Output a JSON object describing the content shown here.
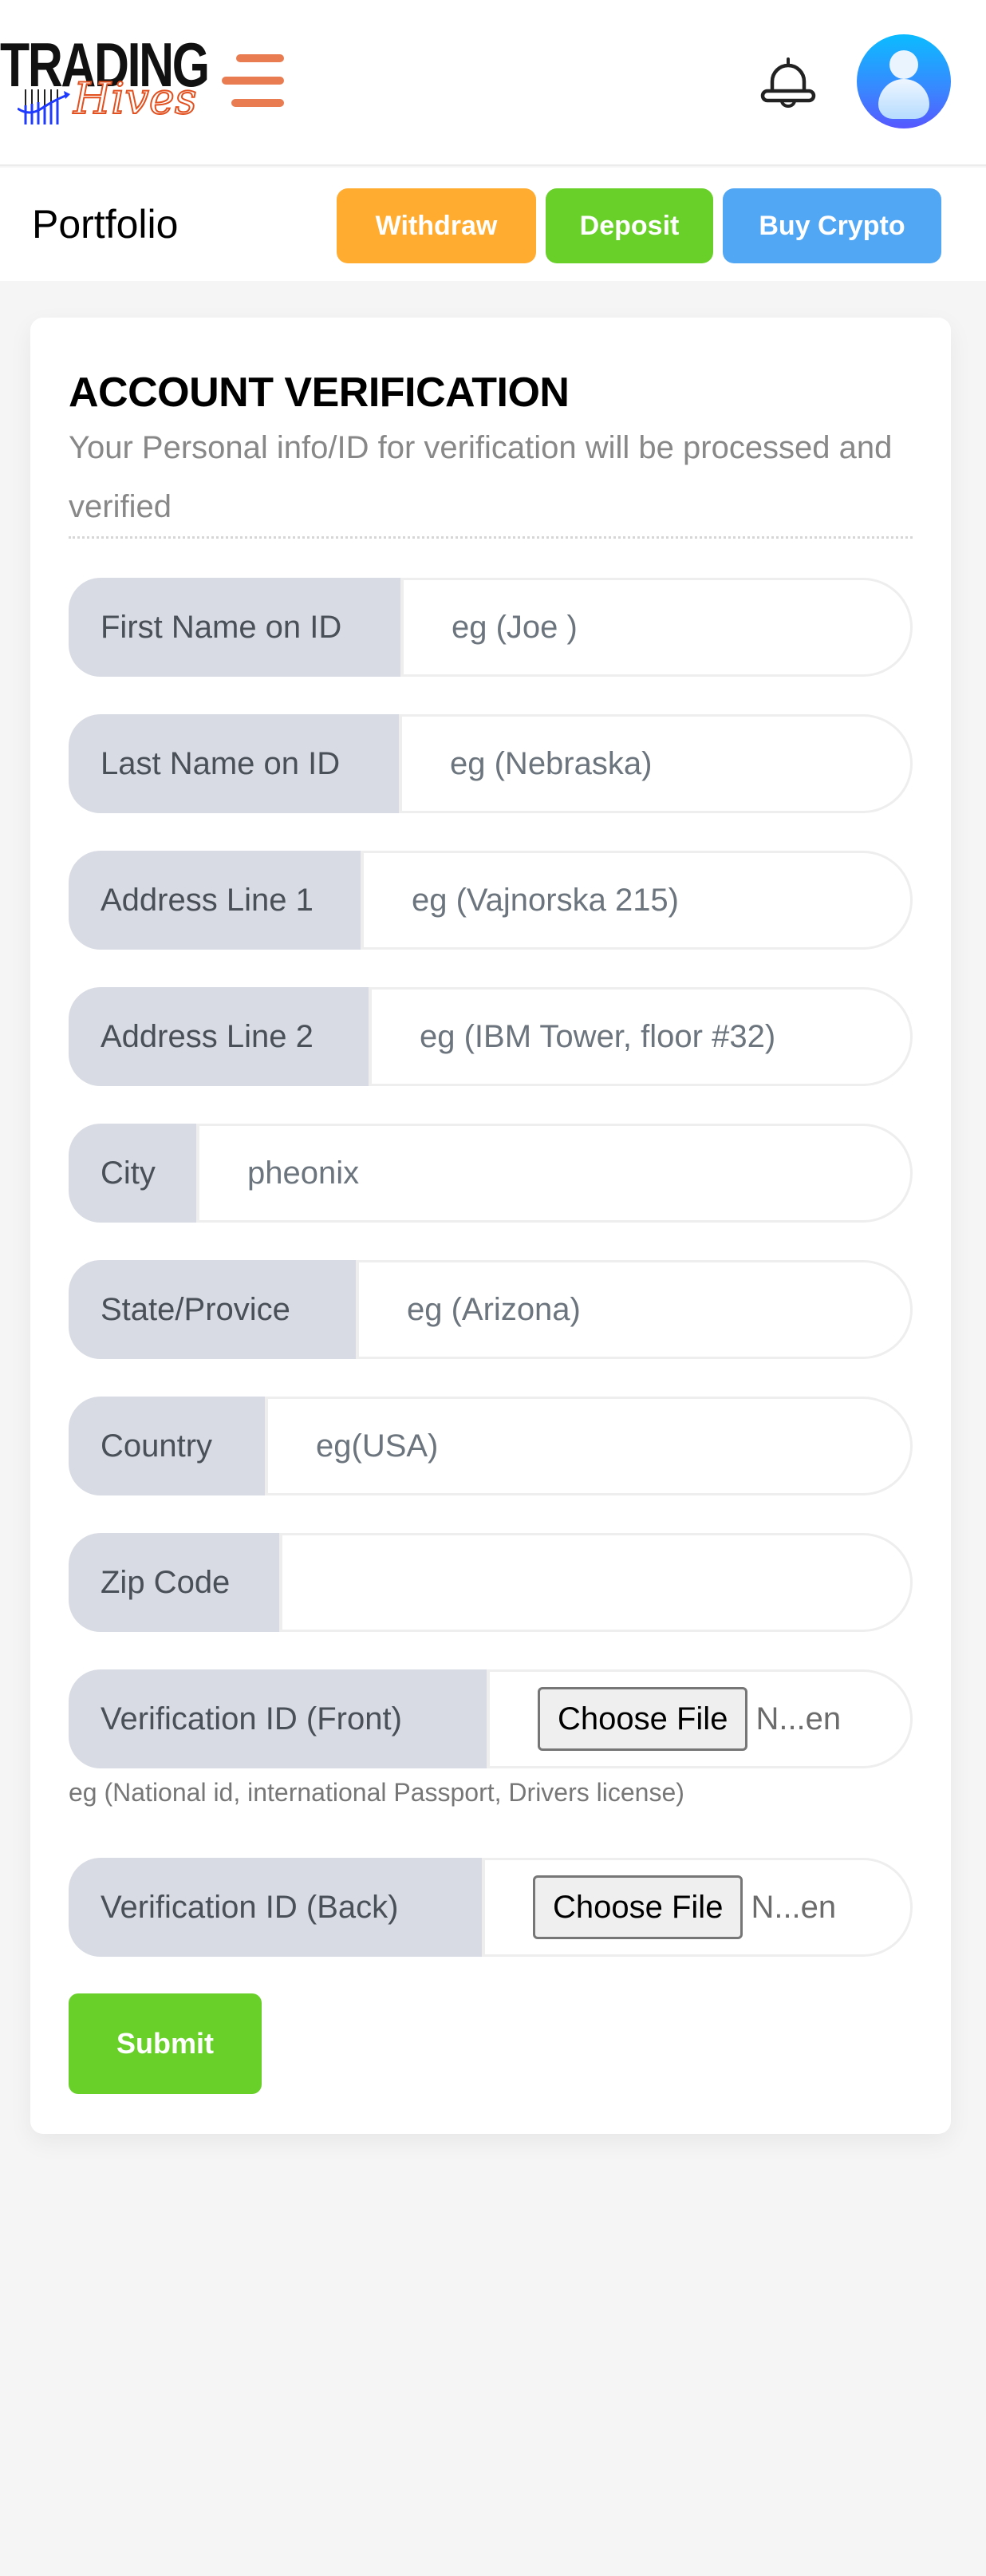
{
  "header": {
    "logo": {
      "word": "TRADING",
      "script": "Hives"
    },
    "menu_icon": "hamburger-menu-icon",
    "notification_icon": "bell-icon",
    "avatar_icon": "user-avatar-icon"
  },
  "subheader": {
    "title": "Portfolio",
    "buttons": [
      {
        "label": "Withdraw",
        "color": "#ffac30"
      },
      {
        "label": "Deposit",
        "color": "#69d02a"
      },
      {
        "label": "Buy Crypto",
        "color": "#52a7f5"
      }
    ]
  },
  "verification": {
    "title": "ACCOUNT VERIFICATION",
    "description": "Your Personal info/ID for verification will be processed and verified",
    "fields": [
      {
        "label": "First Name on ID",
        "value": "",
        "placeholder": "eg (Joe )"
      },
      {
        "label": "Last Name on ID",
        "value": "",
        "placeholder": "eg (Nebraska)"
      },
      {
        "label": "Address Line 1",
        "value": "",
        "placeholder": "eg (Vajnorska 215)"
      },
      {
        "label": "Address Line 2",
        "value": "",
        "placeholder": "eg (IBM Tower, floor #32)"
      },
      {
        "label": "City",
        "value": "pheonix",
        "placeholder": ""
      },
      {
        "label": "State/Provice",
        "value": "",
        "placeholder": "eg (Arizona)"
      },
      {
        "label": "Country",
        "value": "",
        "placeholder": "eg(USA)"
      },
      {
        "label": "Zip Code",
        "value": "",
        "placeholder": ""
      }
    ],
    "file_fields": [
      {
        "label": "Verification ID (Front)",
        "button": "Choose File",
        "status": "N...en"
      },
      {
        "label": "Verification ID (Back)",
        "button": "Choose File",
        "status": "N...en"
      }
    ],
    "front_hint": "eg (National id, international Passport, Drivers license)",
    "submit_label": "Submit"
  }
}
